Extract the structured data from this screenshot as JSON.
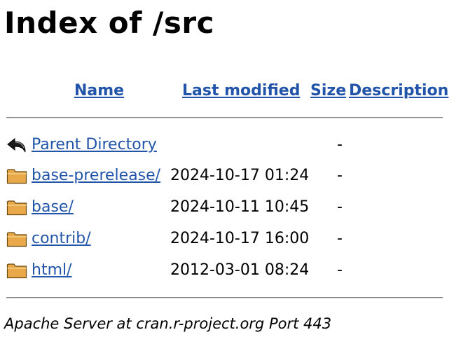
{
  "title": "Index of /src",
  "columns": {
    "name": "Name",
    "last_modified": "Last modified",
    "size": "Size",
    "description": "Description"
  },
  "rows": [
    {
      "icon": "back-icon",
      "name": "Parent Directory",
      "modified": "",
      "size": "-"
    },
    {
      "icon": "folder-icon",
      "name": "base-prerelease/",
      "modified": "2024-10-17 01:24",
      "size": "-"
    },
    {
      "icon": "folder-icon",
      "name": "base/",
      "modified": "2024-10-11 10:45",
      "size": "-"
    },
    {
      "icon": "folder-icon",
      "name": "contrib/",
      "modified": "2024-10-17 16:00",
      "size": "-"
    },
    {
      "icon": "folder-icon",
      "name": "html/",
      "modified": "2012-03-01 08:24",
      "size": "-"
    }
  ],
  "footer": "Apache Server at cran.r-project.org Port 443",
  "colors": {
    "link": "#2255aa",
    "folder": "#e9a94a",
    "rule": "#808080"
  }
}
